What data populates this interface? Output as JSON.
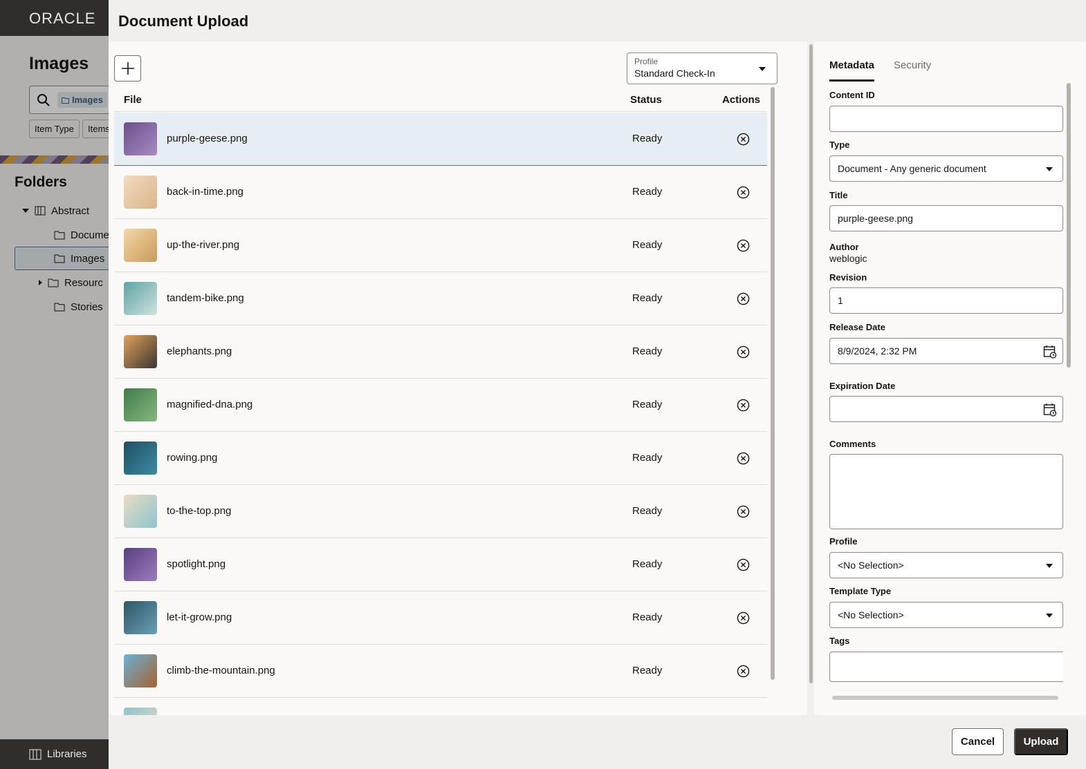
{
  "background": {
    "brand": "ORACLE",
    "page_title": "Images",
    "search_chip": "Images",
    "filters": [
      "Item Type",
      "Items"
    ],
    "folders_title": "Folders",
    "tree": [
      "Abstract",
      "Docume",
      "Images",
      "Resourc",
      "Stories"
    ],
    "footer_label": "Libraries"
  },
  "dialog": {
    "title": "Document Upload",
    "profile": {
      "label": "Profile",
      "value": "Standard Check-In"
    },
    "columns": {
      "file": "File",
      "status": "Status",
      "actions": "Actions"
    },
    "files": [
      {
        "name": "purple-geese.png",
        "status": "Ready",
        "colors": [
          "#6b4f8a",
          "#a58bc2"
        ]
      },
      {
        "name": "back-in-time.png",
        "status": "Ready",
        "colors": [
          "#f3dcc0",
          "#d9b48a"
        ]
      },
      {
        "name": "up-the-river.png",
        "status": "Ready",
        "colors": [
          "#f4d8a8",
          "#c89a5a"
        ]
      },
      {
        "name": "tandem-bike.png",
        "status": "Ready",
        "colors": [
          "#5fa3a3",
          "#cfe3e0"
        ]
      },
      {
        "name": "elephants.png",
        "status": "Ready",
        "colors": [
          "#e0a35a",
          "#3b3431"
        ]
      },
      {
        "name": "magnified-dna.png",
        "status": "Ready",
        "colors": [
          "#3f7d4a",
          "#87b77f"
        ]
      },
      {
        "name": "rowing.png",
        "status": "Ready",
        "colors": [
          "#1f4f63",
          "#3d8aa3"
        ]
      },
      {
        "name": "to-the-top.png",
        "status": "Ready",
        "colors": [
          "#e9dcc3",
          "#8fc3cf"
        ]
      },
      {
        "name": "spotlight.png",
        "status": "Ready",
        "colors": [
          "#5b3f7d",
          "#9b7cc2"
        ]
      },
      {
        "name": "let-it-grow.png",
        "status": "Ready",
        "colors": [
          "#2e5566",
          "#6aa0b5"
        ]
      },
      {
        "name": "climb-the-mountain.png",
        "status": "Ready",
        "colors": [
          "#6ab0d6",
          "#a5622f"
        ]
      }
    ],
    "side_tabs": {
      "metadata": "Metadata",
      "security": "Security"
    },
    "metadata": {
      "content_id_label": "Content ID",
      "content_id": "",
      "type_label": "Type",
      "type": "Document - Any generic document",
      "title_label": "Title",
      "title": "purple-geese.png",
      "author_label": "Author",
      "author": "weblogic",
      "revision_label": "Revision",
      "revision": "1",
      "release_date_label": "Release Date",
      "release_date": "8/9/2024, 2:32 PM",
      "expiration_date_label": "Expiration Date",
      "expiration_date": "",
      "comments_label": "Comments",
      "comments": "",
      "profile_label": "Profile",
      "profile": "<No Selection>",
      "template_type_label": "Template Type",
      "template_type": "<No Selection>",
      "tags_label": "Tags",
      "tags": ""
    },
    "buttons": {
      "cancel": "Cancel",
      "upload": "Upload"
    }
  }
}
